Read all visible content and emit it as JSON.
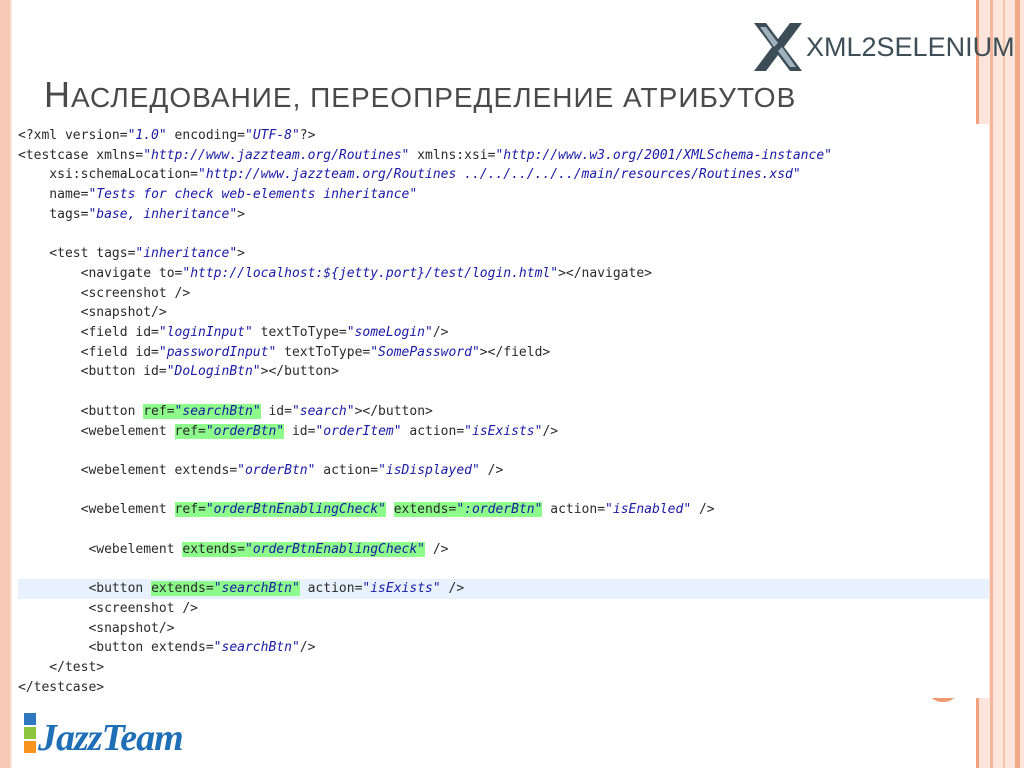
{
  "header": {
    "logo_text": "XML2SELENIUM",
    "logo_icon": "xml2selenium-x-icon",
    "title_first": "Н",
    "title_rest": "АСЛЕДОВАНИЕ, ПЕРЕОПРЕДЕЛЕНИЕ АТРИБУТОВ"
  },
  "colors": {
    "highlight": "#8efc8a",
    "current_line": "#e8f2fe",
    "accent_orange": "#f09a6e",
    "jazzteam_blue": "#1e6fb5"
  },
  "code": {
    "lines": [
      "<?xml version=\"1.0\" encoding=\"UTF-8\"?>",
      "<testcase xmlns=\"http://www.jazzteam.org/Routines\" xmlns:xsi=\"http://www.w3.org/2001/XMLSchema-instance\"",
      "    xsi:schemaLocation=\"http://www.jazzteam.org/Routines ../../../../../main/resources/Routines.xsd\"",
      "    name=\"Tests for check web-elements inheritance\"",
      "    tags=\"base, inheritance\">",
      "",
      "    <test tags=\"inheritance\">",
      "        <navigate to=\"http://localhost:${jetty.port}/test/login.html\"></navigate>",
      "        <screenshot />",
      "        <snapshot/>",
      "        <field id=\"loginInput\" textToType=\"someLogin\"/>",
      "        <field id=\"passwordInput\" textToType=\"SomePassword\"></field>",
      "        <button id=\"DoLoginBtn\"></button>",
      "",
      "        <button ref=\"searchBtn\" id=\"search\"></button>",
      "        <webelement ref=\"orderBtn\" id=\"orderItem\" action=\"isExists\"/>",
      "",
      "        <webelement extends=\"orderBtn\" action=\"isDisplayed\" />",
      "",
      "        <webelement ref=\"orderBtnEnablingCheck\" extends=\":orderBtn\" action=\"isEnabled\" />",
      "",
      "         <webelement extends=\"orderBtnEnablingCheck\" />",
      "",
      "         <button extends=\"searchBtn\" action=\"isExists\" />",
      "         <screenshot />",
      "         <snapshot/>",
      "         <button extends=\"searchBtn\"/>",
      "    </test>",
      "</testcase>"
    ],
    "current_line_index": 23,
    "highlights": [
      {
        "line": 14,
        "text": "ref=\"searchBtn\""
      },
      {
        "line": 15,
        "text": "ref=\"orderBtn\""
      },
      {
        "line": 19,
        "text": "ref=\"orderBtnEnablingCheck\""
      },
      {
        "line": 19,
        "text": "extends=\":orderBtn\""
      },
      {
        "line": 21,
        "text": "extends=\"orderBtnEnablingCheck\""
      },
      {
        "line": 23,
        "text": "extends=\"searchBtn\""
      }
    ]
  },
  "footer": {
    "logo_text": "JazzTeam"
  }
}
